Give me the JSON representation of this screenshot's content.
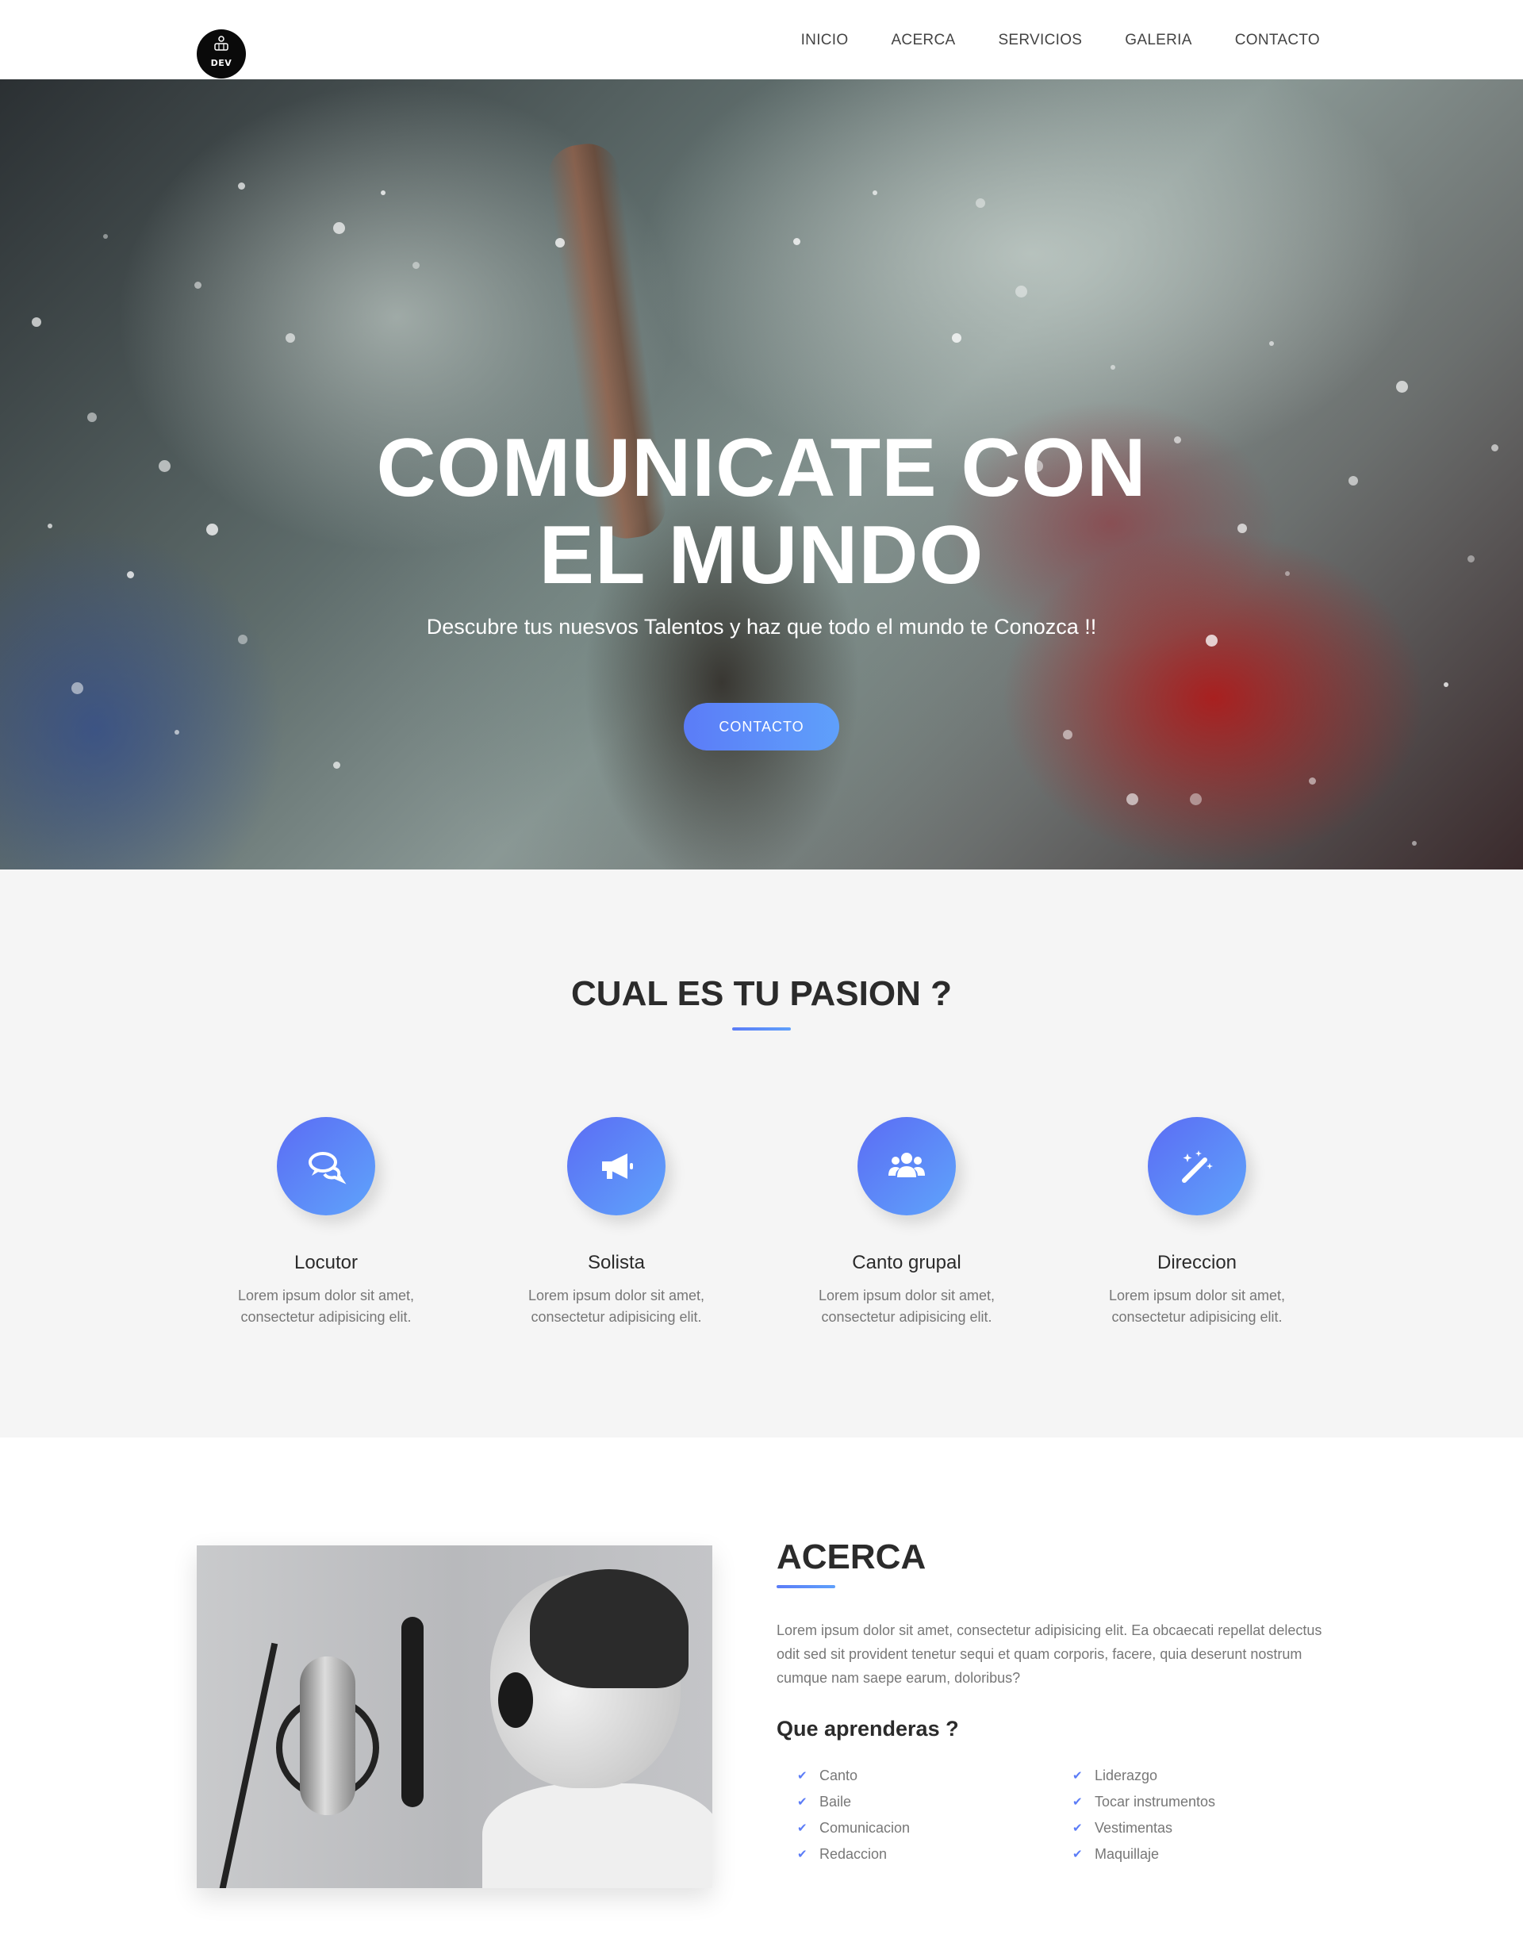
{
  "nav": {
    "logo_text": "DEV",
    "links": [
      "INICIO",
      "ACERCA",
      "SERVICIOS",
      "GALERIA",
      "CONTACTO"
    ]
  },
  "hero": {
    "title_line1": "COMUNICATE CON",
    "title_line2": "EL MUNDO",
    "subtitle": "Descubre tus nuesvos Talentos y haz que todo el mundo te Conozca !!",
    "button": "CONTACTO"
  },
  "services": {
    "title": "CUAL ES TU PASION ?",
    "items": [
      {
        "name": "Locutor",
        "icon": "comments-icon",
        "desc": "Lorem ipsum dolor sit amet, consectetur adipisicing elit."
      },
      {
        "name": "Solista",
        "icon": "bullhorn-icon",
        "desc": "Lorem ipsum dolor sit amet, consectetur adipisicing elit."
      },
      {
        "name": "Canto grupal",
        "icon": "users-icon",
        "desc": "Lorem ipsum dolor sit amet, consectetur adipisicing elit."
      },
      {
        "name": "Direccion",
        "icon": "magic-wand-icon",
        "desc": "Lorem ipsum dolor sit amet, consectetur adipisicing elit."
      }
    ]
  },
  "about": {
    "title": "ACERCA",
    "text": "Lorem ipsum dolor sit amet, consectetur adipisicing elit. Ea obcaecati repellat delectus odit sed sit provident tenetur sequi et quam corporis, facere, quia deserunt nostrum cumque nam saepe earum, doloribus?",
    "subtitle": "Que aprenderas ?",
    "list_left": [
      "Canto",
      "Baile",
      "Comunicacion",
      "Redaccion"
    ],
    "list_right": [
      "Liderazgo",
      "Tocar instrumentos",
      "Vestimentas",
      "Maquillaje"
    ]
  },
  "colors": {
    "accent_start": "#5b7cf7",
    "accent_end": "#5fa0fb",
    "section_bg": "#f5f5f5",
    "heading": "#2b2b2b",
    "body_text": "#777777"
  }
}
